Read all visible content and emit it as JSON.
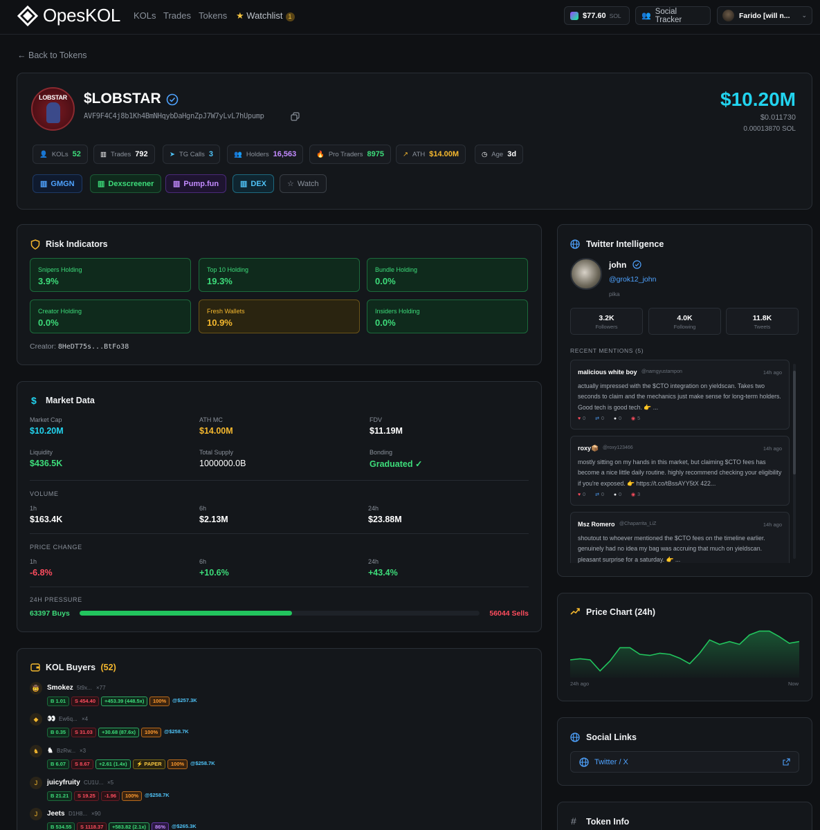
{
  "nav": {
    "brand": "OpesKOL",
    "links": [
      "KOLs",
      "Trades",
      "Tokens"
    ],
    "watchlist_label": "Watchlist",
    "watchlist_count": "1",
    "sol_price": "$77.60",
    "sol_unit": "SOL",
    "social_tracker": "Social Tracker",
    "user_label": "Farido [will n..."
  },
  "back_link": "Back to Tokens",
  "token": {
    "logo_text": "LOBSTAR",
    "symbol": "$LOBSTAR",
    "address": "AVF9F4C4j8b1Kh4BmNHqybDaHgnZpJ7W7yLvL7hUpump",
    "market_cap": "$10.20M",
    "price_usd": "$0.011730",
    "price_sol": "0.00013870 SOL"
  },
  "stats": [
    {
      "label": "KOLs",
      "value": "52",
      "color": "#3ddc7a"
    },
    {
      "label": "Trades",
      "value": "792",
      "color": "#ffffff"
    },
    {
      "label": "TG Calls",
      "value": "3",
      "color": "#4fc3f7"
    },
    {
      "label": "Holders",
      "value": "16,563",
      "color": "#c38bff"
    },
    {
      "label": "Pro Traders",
      "value": "8975",
      "color": "#3ddc7a"
    },
    {
      "label": "ATH",
      "value": "$14.00M",
      "color": "#f5b82e"
    },
    {
      "label": "Age",
      "value": "3d",
      "color": "#ffffff"
    }
  ],
  "links": [
    {
      "label": "GMGN",
      "color": "#4fa3ff"
    },
    {
      "label": "Dexscreener",
      "color": "#3ddc7a"
    },
    {
      "label": "Pump.fun",
      "color": "#c38bff"
    },
    {
      "label": "DEX",
      "color": "#4fc3f7"
    },
    {
      "label": "Watch",
      "color": "#8b929c"
    }
  ],
  "risk": {
    "title": "Risk Indicators",
    "items": [
      {
        "label": "Snipers Holding",
        "value": "3.9%"
      },
      {
        "label": "Top 10 Holding",
        "value": "19.3%"
      },
      {
        "label": "Bundle Holding",
        "value": "0.0%"
      },
      {
        "label": "Creator Holding",
        "value": "0.0%"
      },
      {
        "label": "Fresh Wallets",
        "value": "10.9%"
      },
      {
        "label": "Insiders Holding",
        "value": "0.0%"
      }
    ],
    "creator_label": "Creator:",
    "creator_value": "8HeDT75s...BtFo38"
  },
  "market": {
    "title": "Market Data",
    "market_cap_label": "Market Cap",
    "market_cap": "$10.20M",
    "ath_label": "ATH MC",
    "ath": "$14.00M",
    "fdv_label": "FDV",
    "fdv": "$11.19M",
    "liquidity_label": "Liquidity",
    "liquidity": "$436.5K",
    "supply_label": "Total Supply",
    "supply": "1000000.0B",
    "bonding_label": "Bonding",
    "bonding": "Graduated ✓",
    "volume_title": "VOLUME",
    "vol_1h_label": "1h",
    "vol_1h": "$163.4K",
    "vol_6h_label": "6h",
    "vol_6h": "$2.13M",
    "vol_24h_label": "24h",
    "vol_24h": "$23.88M",
    "change_title": "PRICE CHANGE",
    "chg_1h_label": "1h",
    "chg_1h": "-6.8%",
    "chg_6h_label": "6h",
    "chg_6h": "+10.6%",
    "chg_24h_label": "24h",
    "chg_24h": "+43.4%",
    "pressure_title": "24H PRESSURE",
    "buys": "63397 Buys",
    "sells": "56044 Sells",
    "buy_fraction": 0.531
  },
  "kol": {
    "title": "KOL Buyers",
    "count": "(52)",
    "rows": [
      {
        "avatar": "🤠",
        "name": "Smokez",
        "addr": "5t9x...",
        "trades": "×77",
        "buy": "B 1.01",
        "sell": "S 454.40",
        "pnl": "+453.39 (448.5x)",
        "tag": "",
        "pct": "100%",
        "mc": "@$257.3K",
        "pnl_class": "pp",
        "pct_class": "pc"
      },
      {
        "avatar": "◆",
        "name": "👀",
        "addr": "Ew6q...",
        "trades": "×4",
        "buy": "B 0.35",
        "sell": "S 31.03",
        "pnl": "+30.68 (87.6x)",
        "tag": "",
        "pct": "100%",
        "mc": "@$258.7K",
        "pnl_class": "pp",
        "pct_class": "pc"
      },
      {
        "avatar": "♞",
        "name": "♞",
        "addr": "BzRw...",
        "trades": "×3",
        "buy": "B 6.07",
        "sell": "S 8.67",
        "pnl": "+2.61 (1.4x)",
        "tag": "⚡ PAPER",
        "pct": "100%",
        "mc": "@$258.7K",
        "pnl_class": "pp",
        "pct_class": "pc"
      },
      {
        "avatar": "J",
        "name": "juicyfruity",
        "addr": "CU1U...",
        "trades": "×5",
        "buy": "B 21.21",
        "sell": "S 19.25",
        "pnl": "-1.96",
        "tag": "",
        "pct": "100%",
        "mc": "@$258.7K",
        "pnl_class": "ps",
        "pct_class": "pc"
      },
      {
        "avatar": "J",
        "name": "Jeets",
        "addr": "D1H8...",
        "trades": "×90",
        "buy": "B 534.55",
        "sell": "S 1118.37",
        "pnl": "+583.82 (2.1x)",
        "tag": "",
        "pct": "86%",
        "mc": "@$265.3K",
        "pnl_class": "pp",
        "pct_class": "pv"
      }
    ]
  },
  "twitter": {
    "title": "Twitter Intelligence",
    "name": "john",
    "handle": "@grok12_john",
    "bio": "pika",
    "followers": "3.2K",
    "followers_label": "Followers",
    "following": "4.0K",
    "following_label": "Following",
    "tweets": "11.8K",
    "tweets_label": "Tweets",
    "mentions_title": "RECENT MENTIONS (5)",
    "mentions": [
      {
        "name": "malicious white boy",
        "handle": "@namgyustampon",
        "time": "14h ago",
        "text": "actually impressed with the $CTO integration on yieldscan. Takes two seconds to claim and the mechanics just make sense for long-term holders. Good tech is good tech. 👉 ...",
        "likes": "0",
        "rts": "0",
        "replies": "0",
        "views": "5"
      },
      {
        "name": "roxy📦",
        "handle": "@roxy123466",
        "time": "14h ago",
        "text": "mostly sitting on my hands in this market, but claiming $CTO fees has become a nice little daily routine. highly recommend checking your eligibility if you're exposed. 👉 https://t.co/tBssAYY5tX 422...",
        "likes": "0",
        "rts": "0",
        "replies": "0",
        "views": "3"
      },
      {
        "name": "Msz Romero",
        "handle": "@Chaparrita_LiZ",
        "time": "14h ago",
        "text": "shoutout to whoever mentioned the $CTO fees on the timeline earlier. genuinely had no idea my bag was accruing that much on yieldscan. pleasant surprise for a saturday. 👉 ...",
        "likes": "",
        "rts": "",
        "replies": "",
        "views": ""
      }
    ]
  },
  "price_chart": {
    "title": "Price Chart (24h)",
    "start_label": "24h ago",
    "end_label": "Now"
  },
  "chart_data": {
    "type": "area",
    "title": "Price Chart (24h)",
    "x_labels": [
      "24h ago",
      "Now"
    ],
    "values": [
      30,
      32,
      30,
      10,
      28,
      52,
      52,
      40,
      38,
      42,
      40,
      33,
      23,
      42,
      66,
      58,
      63,
      58,
      75,
      82,
      82,
      72,
      60,
      63
    ],
    "color": "#22c55e"
  },
  "social": {
    "title": "Social Links",
    "twitter_label": "Twitter / X"
  },
  "token_info": {
    "title": "Token Info"
  }
}
